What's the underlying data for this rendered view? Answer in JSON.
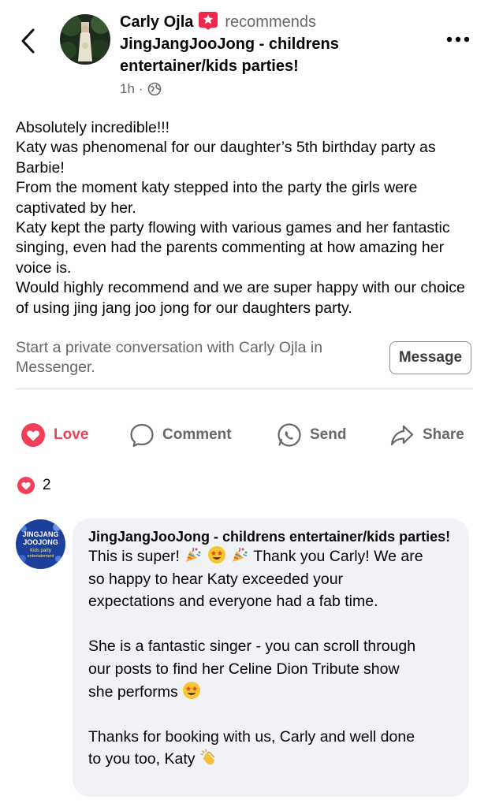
{
  "header": {
    "author": "Carly Ojla",
    "recommends": "recommends",
    "page_name_line1": "JingJangJooJong - childrens",
    "page_name_line2": "entertainer/kids parties!",
    "time": "1h",
    "separator": "·"
  },
  "post": {
    "paragraphs": [
      "Absolutely incredible!!!",
      "Katy was phenomenal for our daughter’s 5th birthday party as Barbie!",
      "From the moment katy stepped into the party the girls were captivated by her.",
      "Katy kept the party flowing with various games and her fantastic singing, even had the parents commenting at how amazing her voice is.",
      "Would highly recommend and we are super happy with our choice of using jing jang joo jong for our daughters party."
    ]
  },
  "messenger": {
    "prompt": "Start a private conversation with Carly Ojla in Messenger.",
    "button_label": "Message"
  },
  "actions": {
    "love": "Love",
    "comment": "Comment",
    "send": "Send",
    "share": "Share"
  },
  "reactions": {
    "count": "2"
  },
  "comment": {
    "author": "JingJangJooJong - childrens entertainer/kids parties!",
    "line1_a": "This is super!",
    "line1_b": "Thank you Carly! We are",
    "line2": "so happy to hear Katy exceeded your",
    "line3": "expectations and everyone had a fab time.",
    "para2_line1": "She is a fantastic singer - you can scroll through",
    "para2_line2": "our posts to find her Celine Dion Tribute show",
    "para2_line3": "she performs",
    "para3_line1": "Thanks for booking with us, Carly and well done",
    "para3_line2": "to you too, Katy",
    "avatar_text_line1": "JINGJANG",
    "avatar_text_line2": "JOOJONG",
    "avatar_text_line3": "Kids party",
    "avatar_text_line4": "entertainment"
  },
  "icons": {
    "back": "chevron-left-icon",
    "more": "more-dots-icon",
    "recommend": "recommend-badge-icon",
    "globe": "globe-icon",
    "love": "love-reaction-icon",
    "comment": "comment-bubble-icon",
    "send": "messenger-send-icon",
    "share": "share-arrow-icon"
  },
  "colors": {
    "love": "#f33e58",
    "recommend_badge": "#f02849",
    "bubble_bg": "#f0f2f5",
    "secondary_text": "#65676b"
  }
}
